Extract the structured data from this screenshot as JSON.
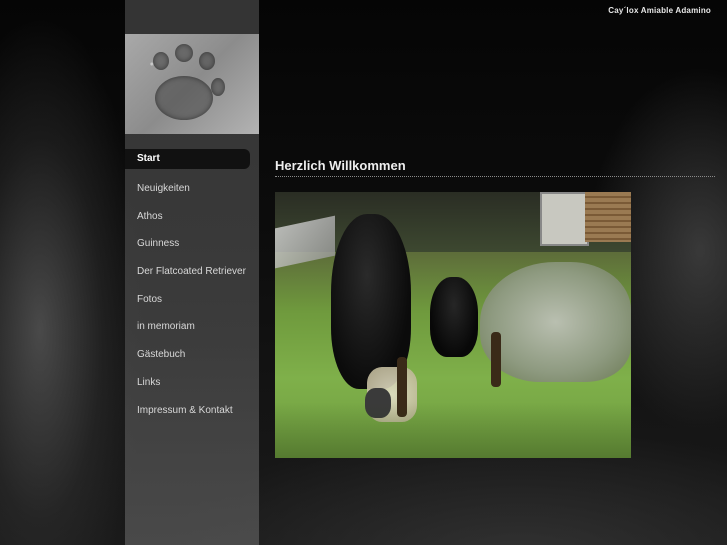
{
  "site": {
    "brand": "Cay´lox Amiable Adamino"
  },
  "menu": {
    "items": [
      {
        "label": "Start",
        "active": true
      },
      {
        "label": "Neuigkeiten"
      },
      {
        "label": "Athos"
      },
      {
        "label": "Guinness"
      },
      {
        "label": "Der Flatcoated Retriever"
      },
      {
        "label": "Fotos"
      },
      {
        "label": "in memoriam"
      },
      {
        "label": "Gästebuch"
      },
      {
        "label": "Links"
      },
      {
        "label": "Impressum & Kontakt"
      }
    ]
  },
  "main": {
    "heading": "Herzlich Willkommen"
  },
  "icons": {
    "header_image": "paw-print-icon"
  }
}
